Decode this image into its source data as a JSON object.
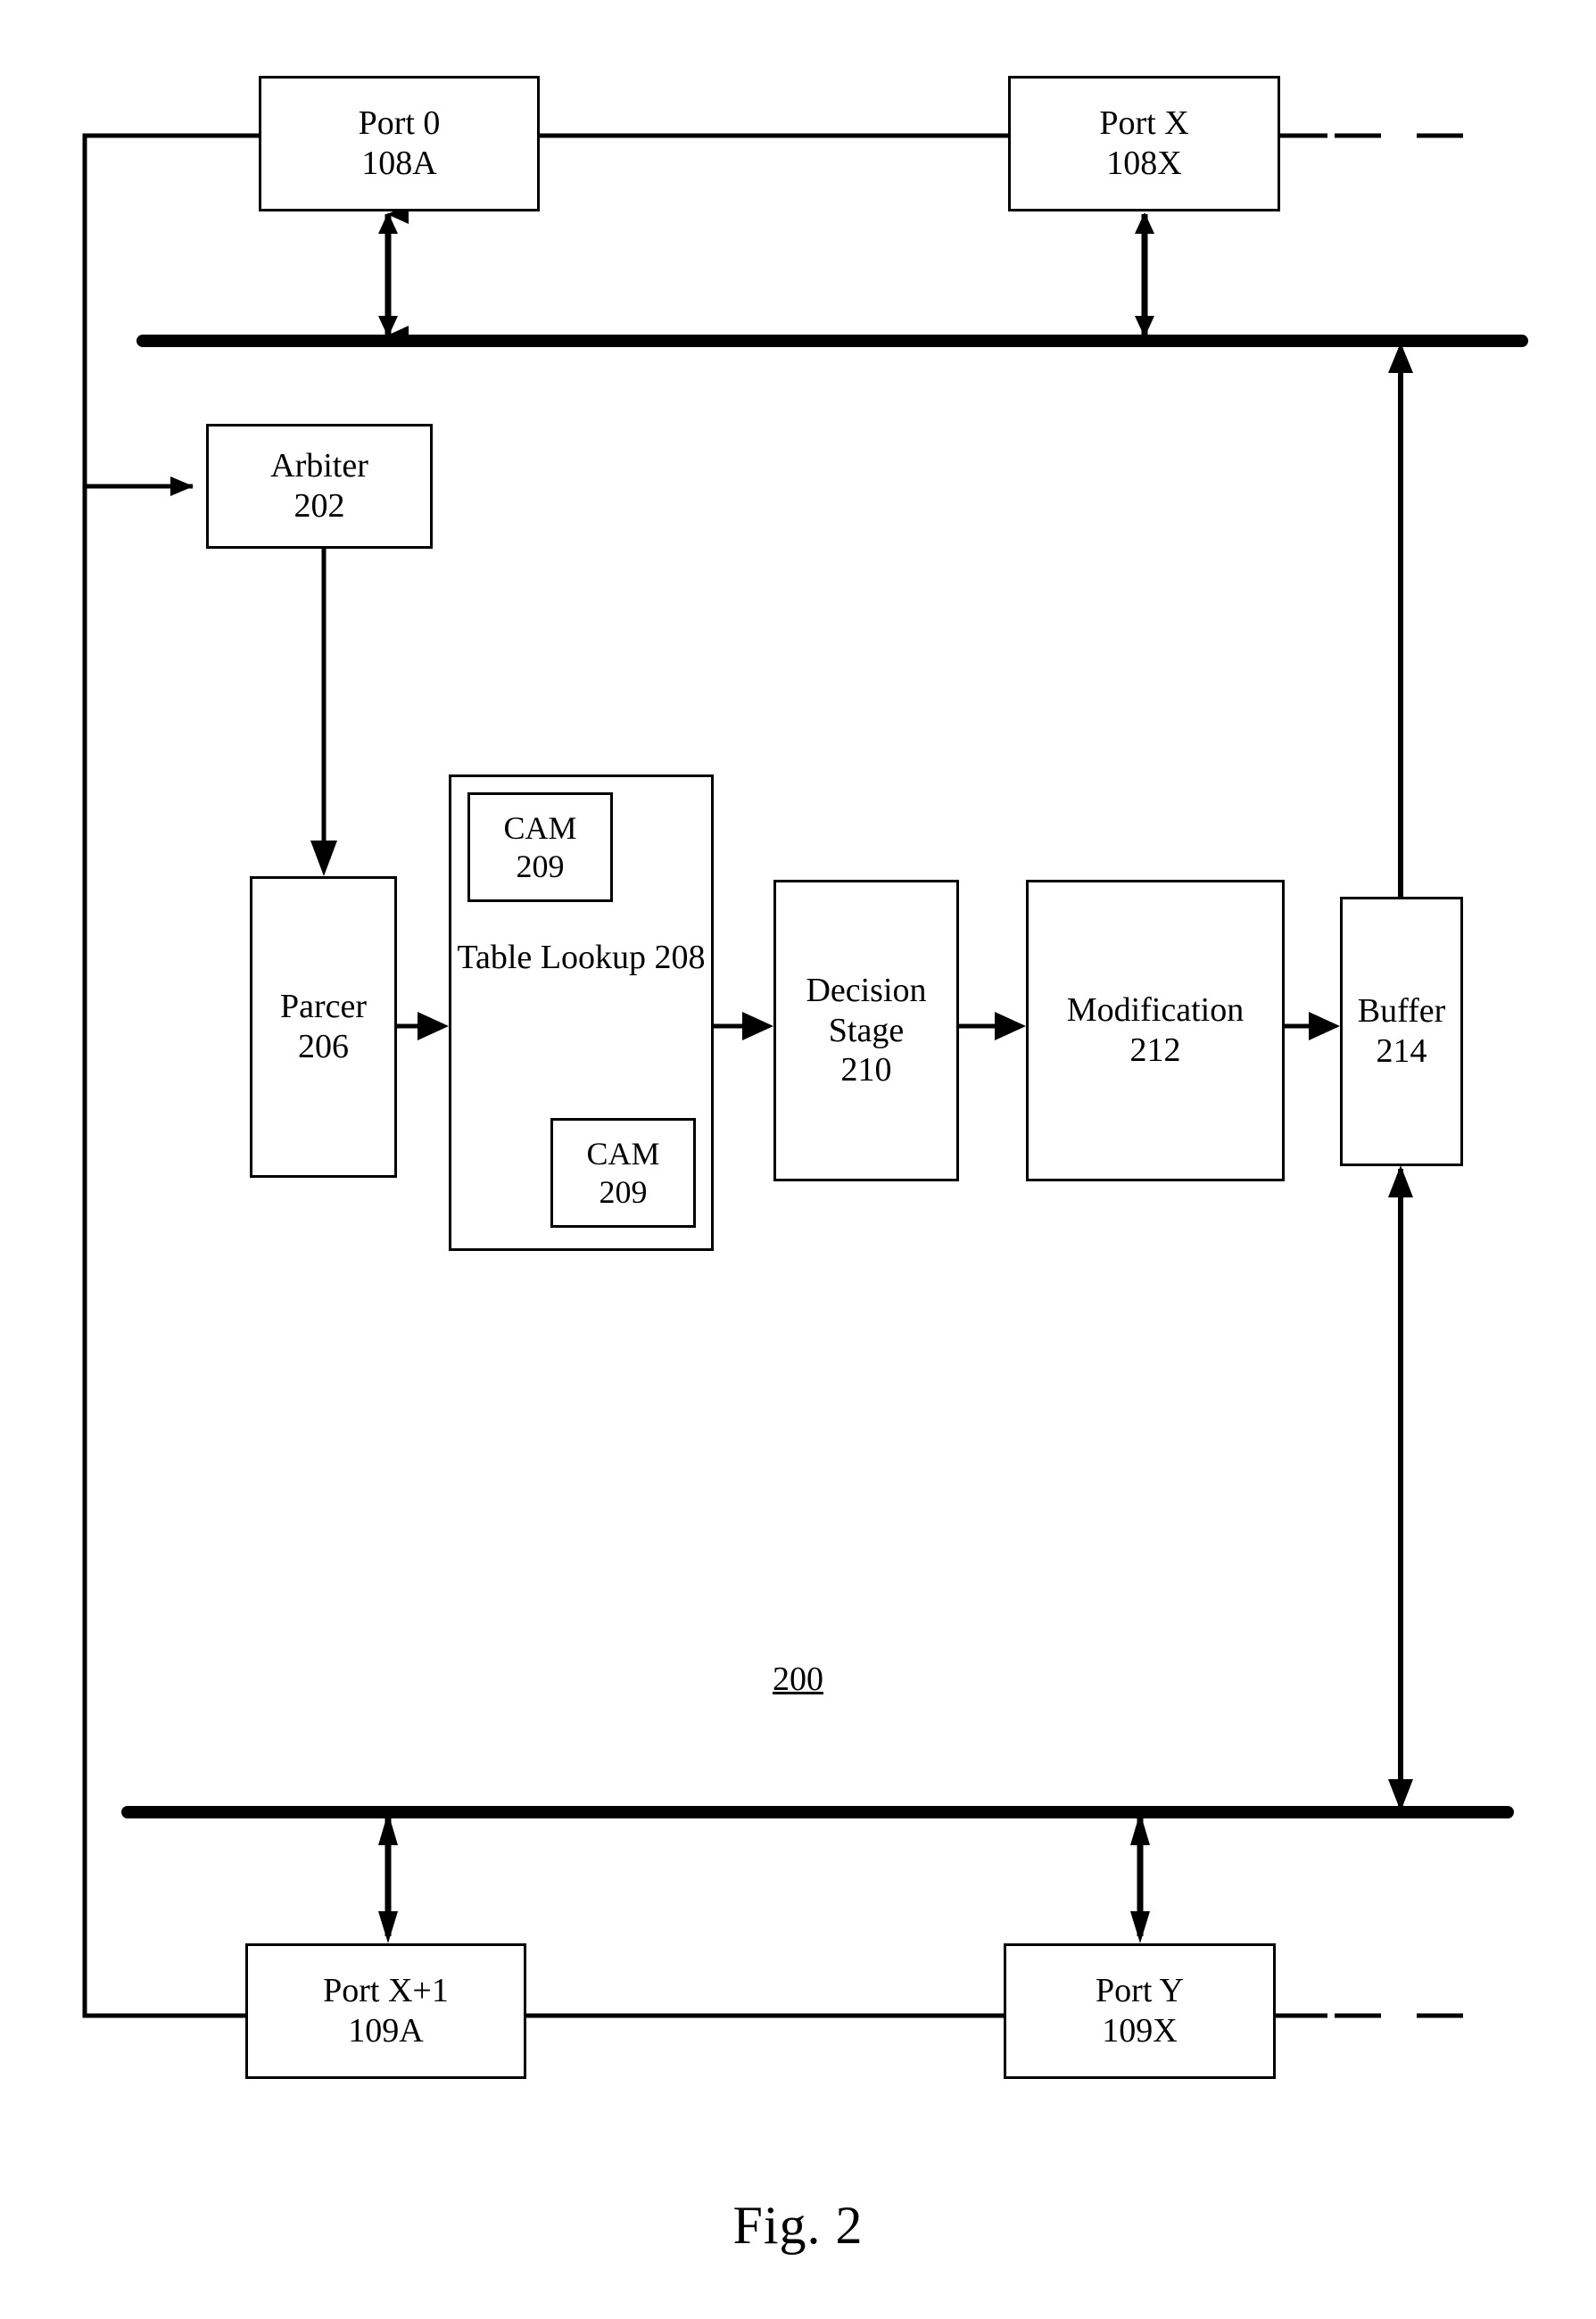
{
  "figure": {
    "caption": "Fig. 2",
    "system_ref": "200"
  },
  "colors": {
    "stroke": "#000000",
    "background": "#ffffff"
  },
  "blocks": {
    "port0": {
      "title": "Port 0",
      "ref": "108A"
    },
    "portx": {
      "title": "Port X",
      "ref": "108X"
    },
    "arbiter": {
      "title": "Arbiter",
      "ref": "202"
    },
    "parcer": {
      "title": "Parcer",
      "ref": "206"
    },
    "table_lookup": {
      "title_line1": "Table",
      "title_line2": "Lookup",
      "ref": "208"
    },
    "cam_top": {
      "title": "CAM",
      "ref": "209"
    },
    "cam_bottom": {
      "title": "CAM",
      "ref": "209"
    },
    "decision": {
      "title_line1": "Decision",
      "title_line2": "Stage",
      "ref": "210"
    },
    "modification": {
      "title": "Modification",
      "ref": "212"
    },
    "buffer": {
      "title": "Buffer",
      "ref": "214"
    },
    "portxplus1": {
      "title": "Port X+1",
      "ref": "109A"
    },
    "porty": {
      "title": "Port Y",
      "ref": "109X"
    }
  },
  "buses": {
    "top_bus": "upper-port-bus",
    "bottom_bus": "lower-port-bus"
  },
  "connections": [
    {
      "name": "port0-to-top-bus",
      "type": "bidirectional"
    },
    {
      "name": "portx-to-top-bus",
      "type": "bidirectional"
    },
    {
      "name": "port0-to-left-rail",
      "type": "line"
    },
    {
      "name": "port0-to-portx",
      "type": "line"
    },
    {
      "name": "portx-dashed-extension",
      "type": "dashed"
    },
    {
      "name": "left-rail-to-arbiter",
      "type": "arrow"
    },
    {
      "name": "arbiter-to-parcer",
      "type": "arrow"
    },
    {
      "name": "parcer-to-table-lookup",
      "type": "arrow"
    },
    {
      "name": "table-lookup-to-decision",
      "type": "arrow"
    },
    {
      "name": "decision-to-modification",
      "type": "arrow"
    },
    {
      "name": "modification-to-buffer",
      "type": "arrow"
    },
    {
      "name": "buffer-to-top-bus",
      "type": "arrow"
    },
    {
      "name": "buffer-to-bottom-bus",
      "type": "bidirectional"
    },
    {
      "name": "portxplus1-to-bottom-bus",
      "type": "bidirectional"
    },
    {
      "name": "porty-to-bottom-bus",
      "type": "bidirectional"
    },
    {
      "name": "portxplus1-to-left-rail",
      "type": "line"
    },
    {
      "name": "portxplus1-to-porty",
      "type": "line"
    },
    {
      "name": "porty-dashed-extension",
      "type": "dashed"
    }
  ]
}
